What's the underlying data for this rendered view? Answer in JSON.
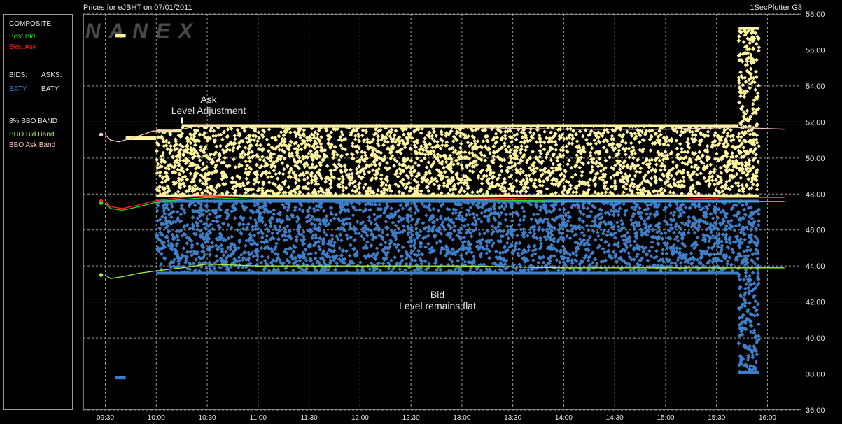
{
  "header": {
    "title": "Prices for  eJBHT  on  07/01/2011",
    "app": "1SecPlotter G3"
  },
  "watermark": "NANEX",
  "legend": {
    "composite_label": "COMPOSITE:",
    "best_bid": "Best Bid",
    "best_ask": "Best Ask",
    "bids_label": "BIDS:",
    "asks_label": "ASKS:",
    "bid_exchange": "BATY",
    "ask_exchange": "BATY",
    "band_label": "8% BBO BAND",
    "bbo_bid_band": "BBO Bid Band",
    "bbo_ask_band": "BBO Ask Band"
  },
  "annotations": {
    "ask_line1": "Ask",
    "ask_line2": "Level Adjustment",
    "bid_line1": "Bid",
    "bid_line2": "Level remains flat"
  },
  "colors": {
    "best_bid": "#22dd22",
    "best_ask": "#ff2020",
    "baty_bid": "#3f7fc8",
    "baty_ask": "#fff5a0",
    "bbo_bid_band": "#a6f23c",
    "bbo_ask_band": "#f2c8c0",
    "grid": "#9a9a9a"
  },
  "chart_data": {
    "type": "scatter",
    "title": "Prices for  eJBHT  on  07/01/2011",
    "x_ticks": [
      "09:30",
      "10:00",
      "10:30",
      "11:00",
      "11:30",
      "12:00",
      "12:30",
      "13:00",
      "13:30",
      "14:00",
      "14:30",
      "15:00",
      "15:30",
      "16:00"
    ],
    "y_ticks": [
      "36.00",
      "38.00",
      "40.00",
      "42.00",
      "44.00",
      "46.00",
      "48.00",
      "50.00",
      "52.00",
      "54.00",
      "56.00",
      "58.00"
    ],
    "ylim": [
      36,
      58
    ],
    "xlim": [
      "09:17",
      "16:20"
    ],
    "grid": true,
    "series": [
      {
        "name": "BBO Ask Band",
        "type": "line",
        "points": [
          [
            "09:30",
            51.3
          ],
          [
            "09:33",
            51.0
          ],
          [
            "09:38",
            50.9
          ],
          [
            "09:45",
            51.1
          ],
          [
            "09:52",
            51.3
          ],
          [
            "09:58",
            51.5
          ],
          [
            "10:05",
            51.5
          ],
          [
            "10:15",
            51.6
          ],
          [
            "10:25",
            51.8
          ],
          [
            "11:00",
            51.7
          ],
          [
            "12:00",
            51.7
          ],
          [
            "13:00",
            51.7
          ],
          [
            "14:00",
            51.6
          ],
          [
            "15:00",
            51.6
          ],
          [
            "15:40",
            51.7
          ],
          [
            "16:10",
            51.6
          ]
        ]
      },
      {
        "name": "Best Ask",
        "type": "line",
        "points": [
          [
            "09:30",
            47.6
          ],
          [
            "09:33",
            47.3
          ],
          [
            "09:40",
            47.2
          ],
          [
            "09:50",
            47.4
          ],
          [
            "09:58",
            47.6
          ],
          [
            "10:05",
            47.7
          ],
          [
            "10:15",
            47.8
          ],
          [
            "10:30",
            47.9
          ],
          [
            "11:00",
            47.8
          ],
          [
            "12:00",
            47.8
          ],
          [
            "13:00",
            47.8
          ],
          [
            "14:00",
            47.7
          ],
          [
            "15:00",
            47.7
          ],
          [
            "15:40",
            47.8
          ],
          [
            "16:10",
            47.8
          ]
        ]
      },
      {
        "name": "Best Bid",
        "type": "line",
        "points": [
          [
            "09:30",
            47.5
          ],
          [
            "09:33",
            47.2
          ],
          [
            "09:40",
            47.1
          ],
          [
            "09:50",
            47.3
          ],
          [
            "09:58",
            47.5
          ],
          [
            "10:05",
            47.6
          ],
          [
            "10:15",
            47.7
          ],
          [
            "10:30",
            47.8
          ],
          [
            "11:00",
            47.7
          ],
          [
            "12:00",
            47.7
          ],
          [
            "13:00",
            47.7
          ],
          [
            "14:00",
            47.6
          ],
          [
            "15:00",
            47.6
          ],
          [
            "15:40",
            47.6
          ],
          [
            "16:10",
            47.6
          ]
        ]
      },
      {
        "name": "BBO Bid Band",
        "type": "line",
        "points": [
          [
            "09:30",
            43.5
          ],
          [
            "09:33",
            43.3
          ],
          [
            "09:40",
            43.4
          ],
          [
            "09:50",
            43.6
          ],
          [
            "09:58",
            43.7
          ],
          [
            "10:15",
            43.9
          ],
          [
            "10:30",
            44.1
          ],
          [
            "11:00",
            44.0
          ],
          [
            "12:00",
            44.0
          ],
          [
            "13:00",
            44.0
          ],
          [
            "14:00",
            43.9
          ],
          [
            "15:00",
            43.9
          ],
          [
            "15:40",
            43.9
          ],
          [
            "16:10",
            43.9
          ]
        ]
      },
      {
        "name": "BATY Ask",
        "type": "scatter",
        "segments": [
          {
            "from": "09:36",
            "to": "09:42",
            "lo": 56.8,
            "hi": 56.8
          },
          {
            "from": "09:42",
            "to": "10:00",
            "lo": 51.1,
            "hi": 51.1
          },
          {
            "from": "10:00",
            "to": "10:15",
            "lo": 47.9,
            "hi": 51.5
          },
          {
            "from": "10:15",
            "to": "15:43",
            "lo": 47.9,
            "hi": 51.8
          },
          {
            "from": "15:43",
            "to": "15:55",
            "lo": 47.9,
            "hi": 57.2
          }
        ]
      },
      {
        "name": "BATY Bid",
        "type": "scatter",
        "segments": [
          {
            "from": "09:36",
            "to": "09:42",
            "lo": 37.8,
            "hi": 37.8
          },
          {
            "from": "10:00",
            "to": "15:43",
            "lo": 43.6,
            "hi": 47.6
          },
          {
            "from": "15:43",
            "to": "15:55",
            "lo": 38.1,
            "hi": 47.6
          }
        ]
      }
    ]
  }
}
